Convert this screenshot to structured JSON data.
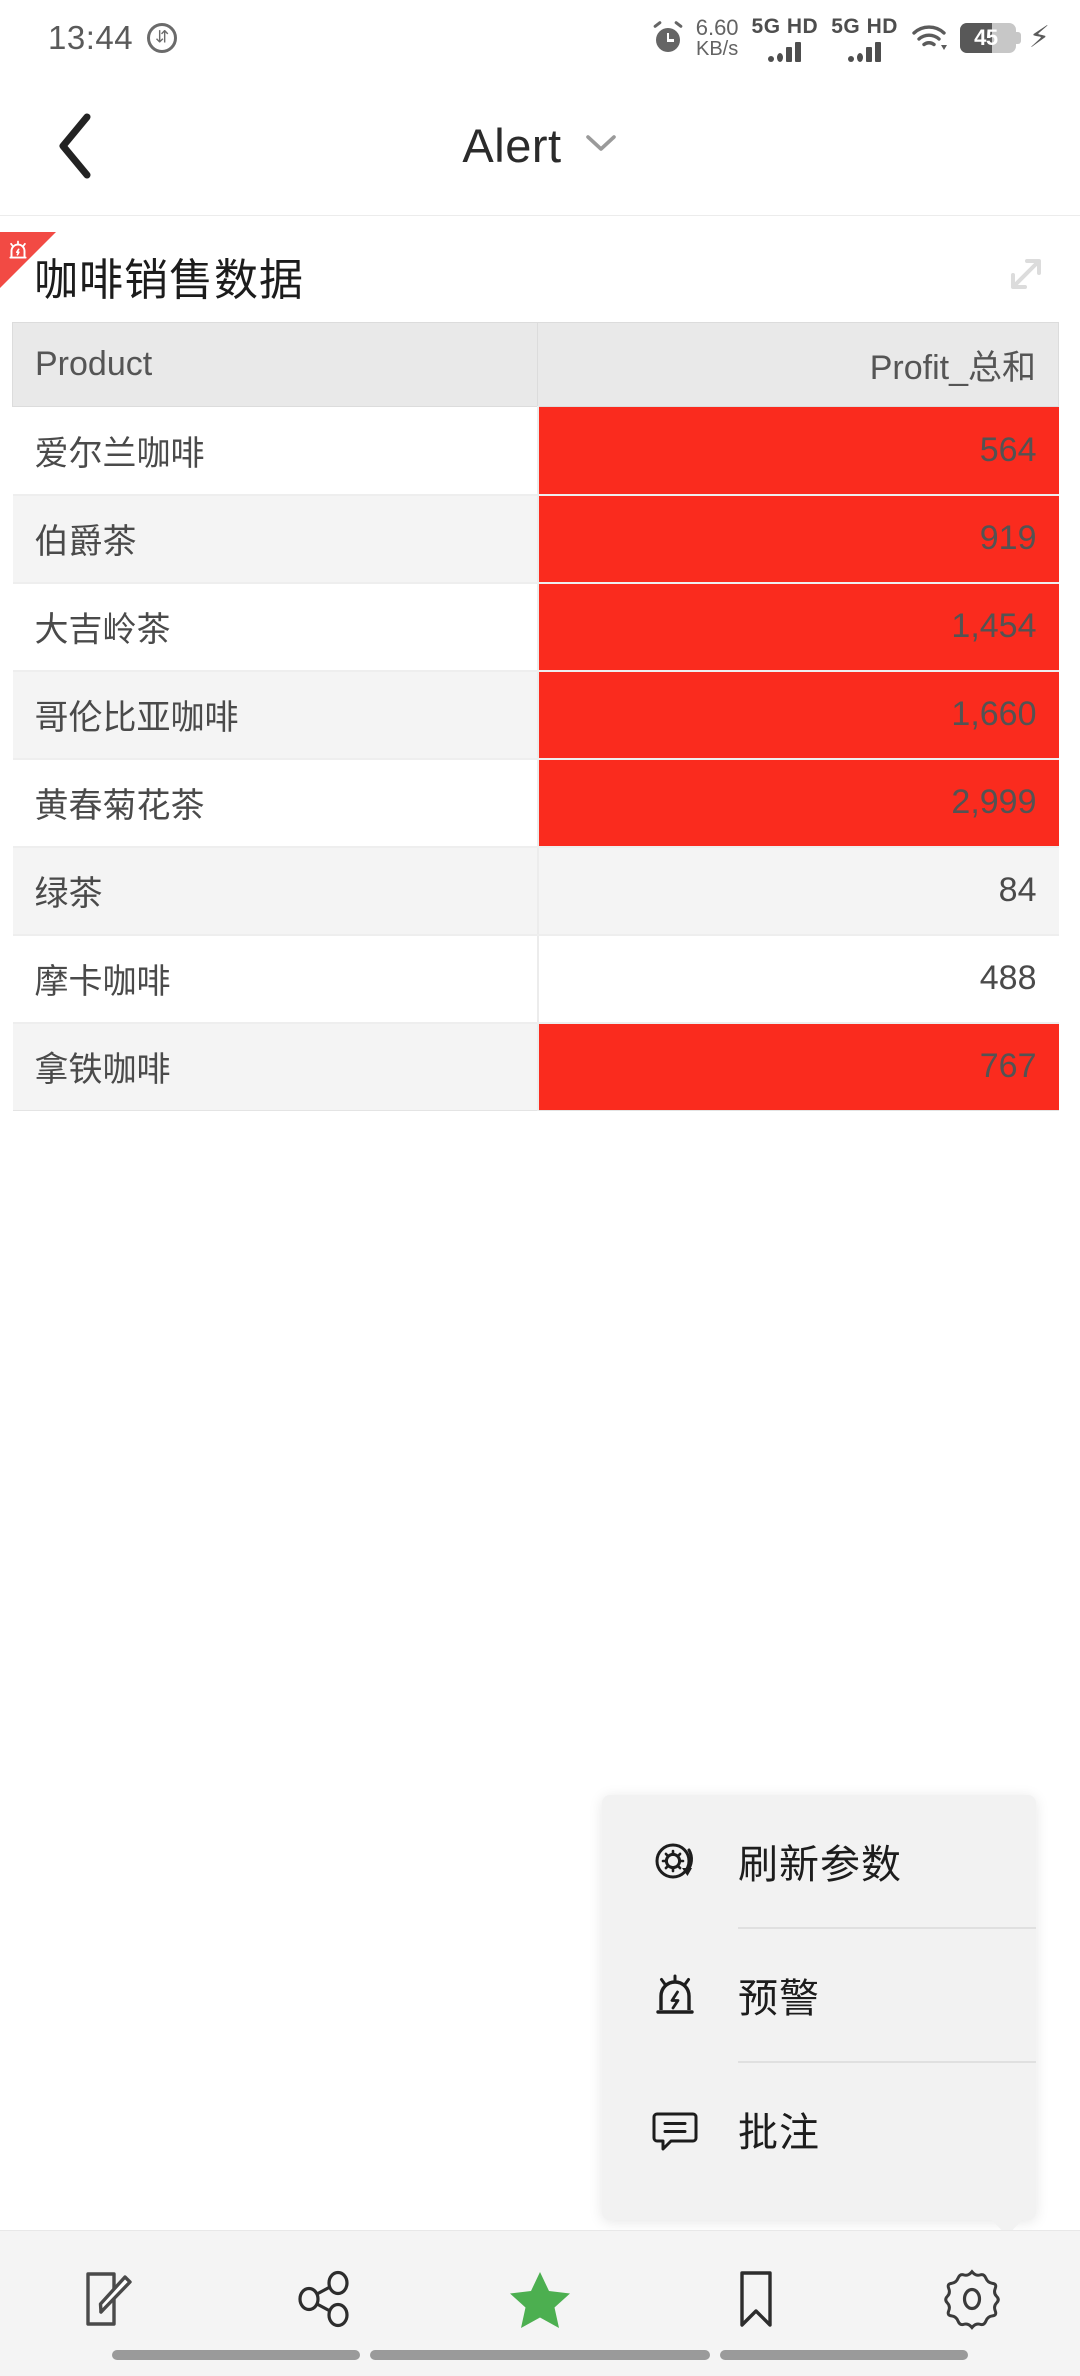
{
  "status_bar": {
    "time": "13:44",
    "download_icon": "download-upload-icon",
    "alarm_icon": "alarm-clock-icon",
    "net_speed_value": "6.60",
    "net_speed_unit": "KB/s",
    "sim1_label": "5G HD",
    "sim2_label": "5G HD",
    "wifi_icon": "wifi-icon",
    "battery_percent": "45",
    "charging_icon": "lightning-bolt-icon"
  },
  "navbar": {
    "back_icon": "chevron-left-icon",
    "title": "Alert",
    "caret_icon": "chevron-down-icon"
  },
  "card": {
    "alert_corner_icon": "siren-alert-icon",
    "title": "咖啡销售数据",
    "expand_icon": "expand-diagonal-icon"
  },
  "table": {
    "columns": [
      "Product",
      "Profit_总和"
    ],
    "rows": [
      {
        "product": "爱尔兰咖啡",
        "profit": "564",
        "alert": true
      },
      {
        "product": "伯爵茶",
        "profit": "919",
        "alert": true
      },
      {
        "product": "大吉岭茶",
        "profit": "1,454",
        "alert": true
      },
      {
        "product": "哥伦比亚咖啡",
        "profit": "1,660",
        "alert": true
      },
      {
        "product": "黄春菊花茶",
        "profit": "2,999",
        "alert": true
      },
      {
        "product": "绿茶",
        "profit": "84",
        "alert": false
      },
      {
        "product": "摩卡咖啡",
        "profit": "488",
        "alert": false
      },
      {
        "product": "拿铁咖啡",
        "profit": "767",
        "alert": true
      }
    ]
  },
  "popup_menu": {
    "items": [
      {
        "icon": "refresh-settings-icon",
        "label": "刷新参数"
      },
      {
        "icon": "siren-alert-icon",
        "label": "预警"
      },
      {
        "icon": "comment-icon",
        "label": "批注"
      }
    ]
  },
  "toolbar": {
    "items": [
      {
        "icon": "edit-note-icon",
        "name": "edit",
        "active": false
      },
      {
        "icon": "share-icon",
        "name": "share",
        "active": false
      },
      {
        "icon": "star-icon",
        "name": "favorite",
        "active": true
      },
      {
        "icon": "bookmark-icon",
        "name": "bookmark",
        "active": false
      },
      {
        "icon": "gear-icon",
        "name": "settings",
        "active": false
      }
    ]
  },
  "colors": {
    "alert_red": "#fa2b1e",
    "corner_red": "#f24a44",
    "active_green": "#4caf50",
    "header_gray": "#e9e9e9",
    "row_alt_gray": "#f4f4f4",
    "toolbar_bg": "#f4f4f4"
  },
  "chart_data": {
    "type": "table",
    "title": "咖啡销售数据",
    "columns": [
      "Product",
      "Profit_总和"
    ],
    "categories": [
      "爱尔兰咖啡",
      "伯爵茶",
      "大吉岭茶",
      "哥伦比亚咖啡",
      "黄春菊花茶",
      "绿茶",
      "摩卡咖啡",
      "拿铁咖啡"
    ],
    "values": [
      564,
      919,
      1454,
      1660,
      2999,
      84,
      488,
      767
    ],
    "highlight_rule": "red background when value exceeds alert threshold",
    "highlighted": [
      true,
      true,
      true,
      true,
      true,
      false,
      false,
      true
    ],
    "xlabel": "Product",
    "ylabel": "Profit_总和"
  }
}
